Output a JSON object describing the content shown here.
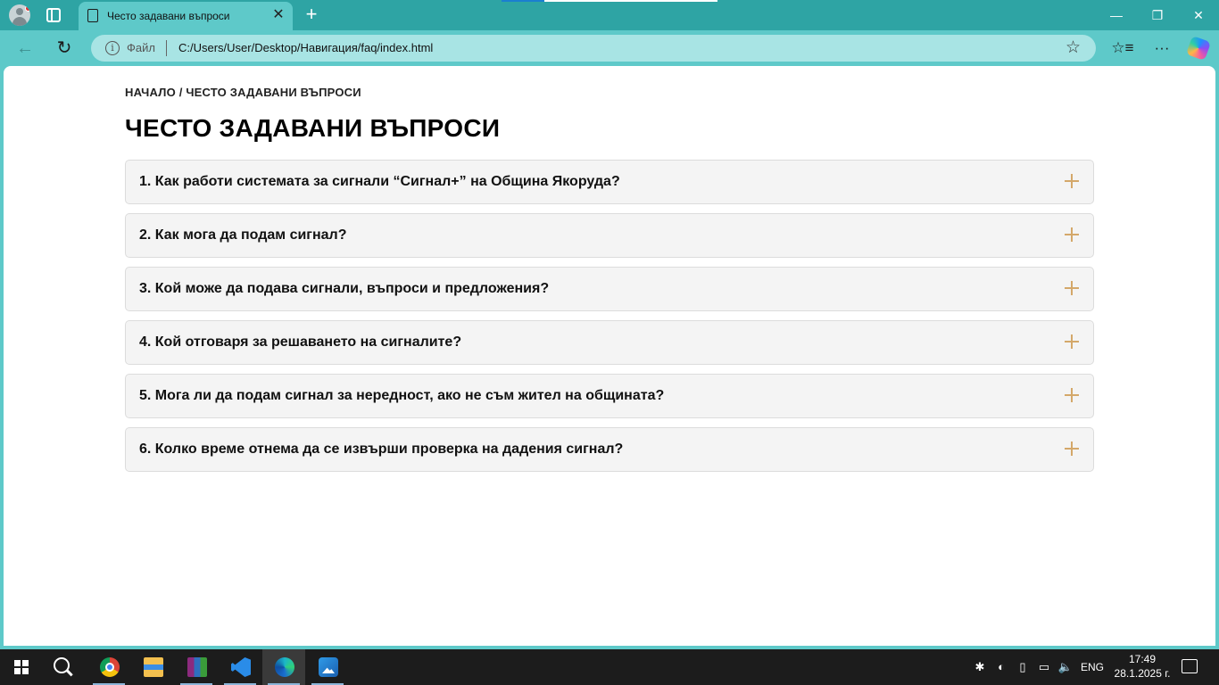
{
  "browser": {
    "tab_title": "Често задавани въпроси",
    "tab_close": "✕",
    "new_tab": "+",
    "scheme_label": "Файл",
    "url": "C:/Users/User/Desktop/Навигация/faq/index.html",
    "window_controls": {
      "minimize": "—",
      "restore": "❐",
      "close": "✕"
    },
    "icons": [
      "profile-icon",
      "tab-actions-icon",
      "page-icon",
      "back-icon",
      "reload-icon",
      "info-icon",
      "favorite-star-icon",
      "favorites-list-icon",
      "more-menu-icon",
      "copilot-icon"
    ],
    "toolbar_glyphs": {
      "back": "←",
      "reload": "↻",
      "info": "i",
      "favorite": "☆",
      "favorites_list": "☆≡",
      "more": "···"
    }
  },
  "page": {
    "breadcrumb": "НАЧАЛО / ЧЕСТО ЗАДАВАНИ ВЪПРОСИ",
    "title": "ЧЕСТО ЗАДАВАНИ ВЪПРОСИ",
    "accent_color": "#d4a86a",
    "faq": [
      {
        "question": "1. Как работи системата за сигнали “Сигнал+” на Община Якоруда?"
      },
      {
        "question": "2. Как мога да подам сигнал?"
      },
      {
        "question": "3. Кой може да подава сигнали, въпроси и предложения?"
      },
      {
        "question": "4. Кой отговаря за решаването на сигналите?"
      },
      {
        "question": "5. Мога ли да подам сигнал за нередност, ако не съм жител на общината?"
      },
      {
        "question": "6. Колко време отнема да се извърши проверка на дадения сигнал?"
      }
    ]
  },
  "taskbar": {
    "apps": [
      "chrome-icon",
      "file-explorer-icon",
      "winrar-icon",
      "vscode-icon",
      "edge-icon",
      "photos-icon"
    ],
    "language": "ENG",
    "time": "17:49",
    "date": "28.1.2025 г."
  }
}
